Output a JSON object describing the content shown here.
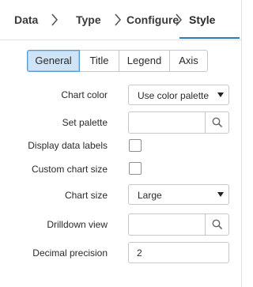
{
  "wizard": {
    "steps": [
      {
        "label": "Data"
      },
      {
        "label": "Type"
      },
      {
        "label": "Configure"
      },
      {
        "label": "Style",
        "active": true
      }
    ],
    "accent_color": "#2d7bb4"
  },
  "tabs": [
    {
      "label": "General",
      "selected": true
    },
    {
      "label": "Title"
    },
    {
      "label": "Legend"
    },
    {
      "label": "Axis"
    }
  ],
  "form": {
    "chart_color": {
      "label": "Chart color",
      "value": "Use color palette"
    },
    "set_palette": {
      "label": "Set palette",
      "value": ""
    },
    "display_data_labels": {
      "label": "Display data labels",
      "checked": false
    },
    "custom_chart_size": {
      "label": "Custom chart size",
      "checked": false
    },
    "chart_size": {
      "label": "Chart size",
      "value": "Large"
    },
    "drilldown_view": {
      "label": "Drilldown view",
      "value": ""
    },
    "decimal_precision": {
      "label": "Decimal precision",
      "value": "2"
    }
  },
  "icons": {
    "step_separator": "chevron-right-icon",
    "lookup": "search-icon",
    "select": "caret-down-icon"
  }
}
